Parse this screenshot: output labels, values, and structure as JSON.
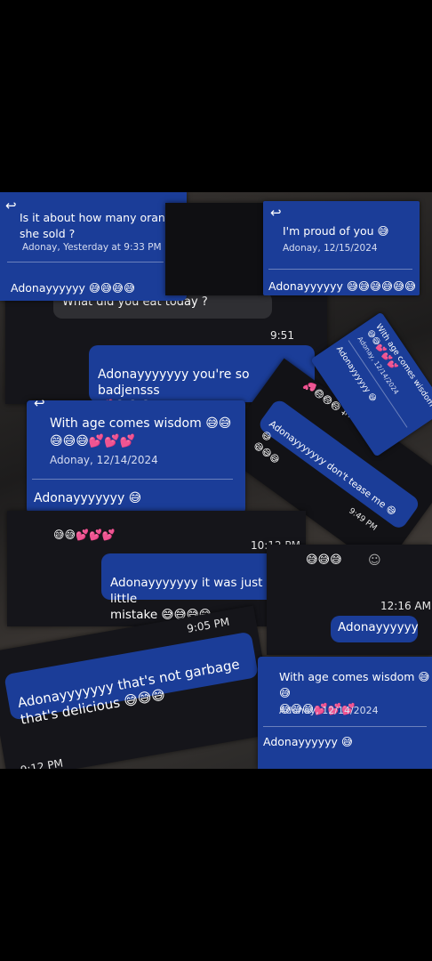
{
  "collage": {
    "card1": {
      "quote": "Is it about how many orang\nshe sold ?",
      "quote_meta": "Adonay, Yesterday at 9:33 PM",
      "reply": "Adonayyyyyy 😅😅😅😅"
    },
    "card2": {
      "quote": "I'm proud of you 😅",
      "quote_meta": "Adonay, 12/15/2024",
      "reply": "Adonayyyyyy 😅😅😅😅😅😅"
    },
    "card3": {
      "grey_text": "What did you eat today ?",
      "time": "9:51",
      "message": "Adonayyyyyyy you're so badjensss\n💕😅😅😅",
      "partial": "Wh..."
    },
    "card4": {
      "quote": "With age comes wisdom 😅😅\n😅😅😅💕💕💕",
      "quote_meta": "Adonay, 12/14/2024",
      "reply": "Adonayyyyyyy 😅"
    },
    "card5": {
      "quote": "With age comes wisdom 😅\n😅😅💕💕💕",
      "quote_meta": "Adonay, 12/14/2024",
      "reply": "Adonayyyyyy 😅"
    },
    "card6": {
      "partial_top": "about 😅😅😅💕",
      "message": "Adonayyyyyyy don't tease me 😅😅\n😅😅😅",
      "time": "9:49 PM"
    },
    "card7": {
      "partial_top": "😅😅💕💕💕",
      "time": "10:12 PM",
      "message": "Adonayyyyyyy it was just a little\nmistake 😅😅😅😅"
    },
    "card8": {
      "partial_left": "😅😅😅",
      "time": "12:16 AM",
      "message": "Adonayyyyyy"
    },
    "card9": {
      "time": "9:05 PM",
      "message": "Adonayyyyyyy that's not garbage\nthat's delicious 😅😅😅",
      "partial_time": "9:12 PM"
    },
    "card10": {
      "quote": "With age comes wisdom 😅😅\n😅😅😅💕💕💕",
      "quote_meta": "Adonay, 12/14/2024",
      "reply": "Adonayyyyyy 😅"
    },
    "icons": {
      "reply": "reply-arrow-icon",
      "smiley": "smiley-icon"
    }
  }
}
